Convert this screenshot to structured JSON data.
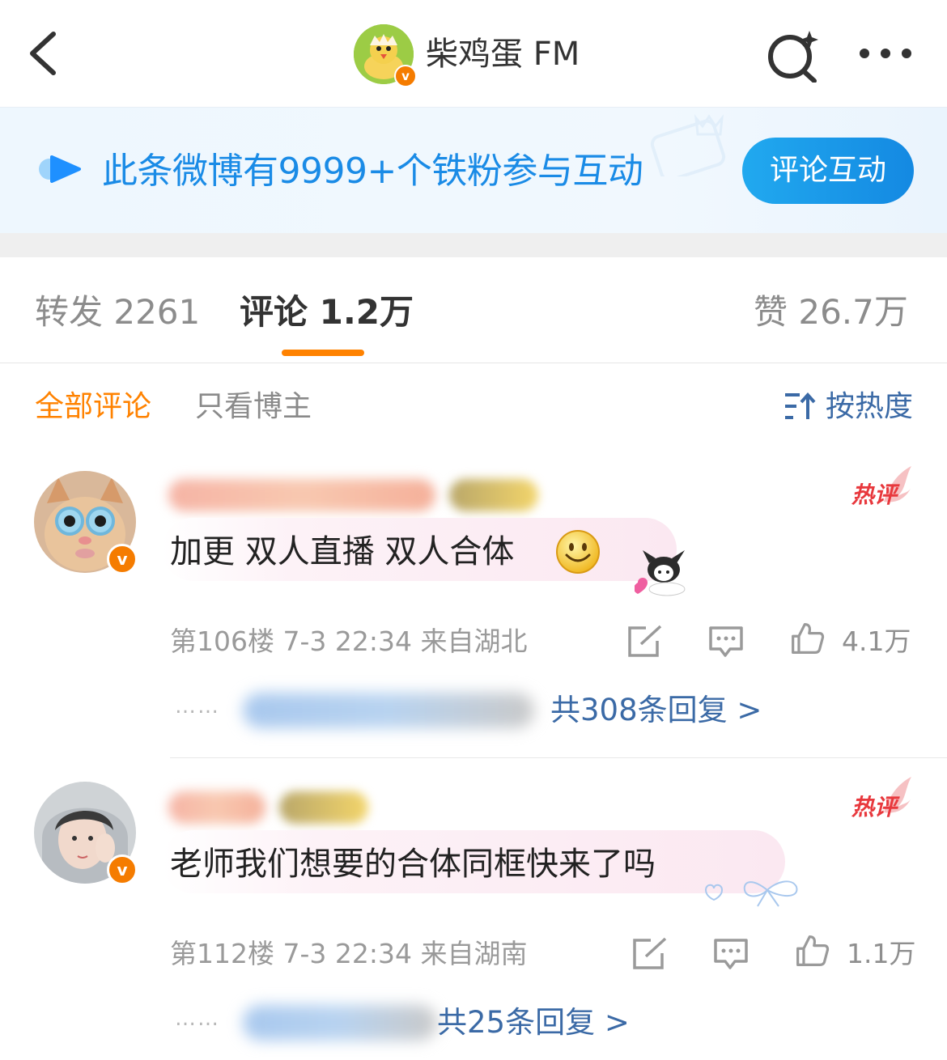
{
  "header": {
    "account_name": "柴鸡蛋 FM",
    "verified_mark": "v"
  },
  "banner": {
    "text": "此条微博有9999+个铁粉参与互动",
    "button_label": "评论互动"
  },
  "tabs": {
    "repost": "转发 2261",
    "comment": "评论 1.2万",
    "like": "赞 26.7万"
  },
  "filters": {
    "all": "全部评论",
    "poster_only": "只看博主",
    "sort": "按热度"
  },
  "comments": [
    {
      "hot_label": "热评",
      "verified_mark": "v",
      "text": "加更 双人直播 双人合体",
      "meta": "第106楼 7-3 22:34 来自湖北",
      "likes": "4.1万",
      "reply_dots": "……",
      "reply_link": "共308条回复 >"
    },
    {
      "hot_label": "热评",
      "verified_mark": "v",
      "text": "老师我们想要的合体同框快来了吗",
      "meta": "第112楼 7-3 22:34 来自湖南",
      "likes": "1.1万",
      "reply_dots": "……",
      "reply_link": "共25条回复 >"
    }
  ],
  "colors": {
    "accent_orange": "#ff8200",
    "link_blue": "#3b6aa6",
    "banner_blue": "#1a8be6",
    "hot_red": "#e8383d"
  }
}
